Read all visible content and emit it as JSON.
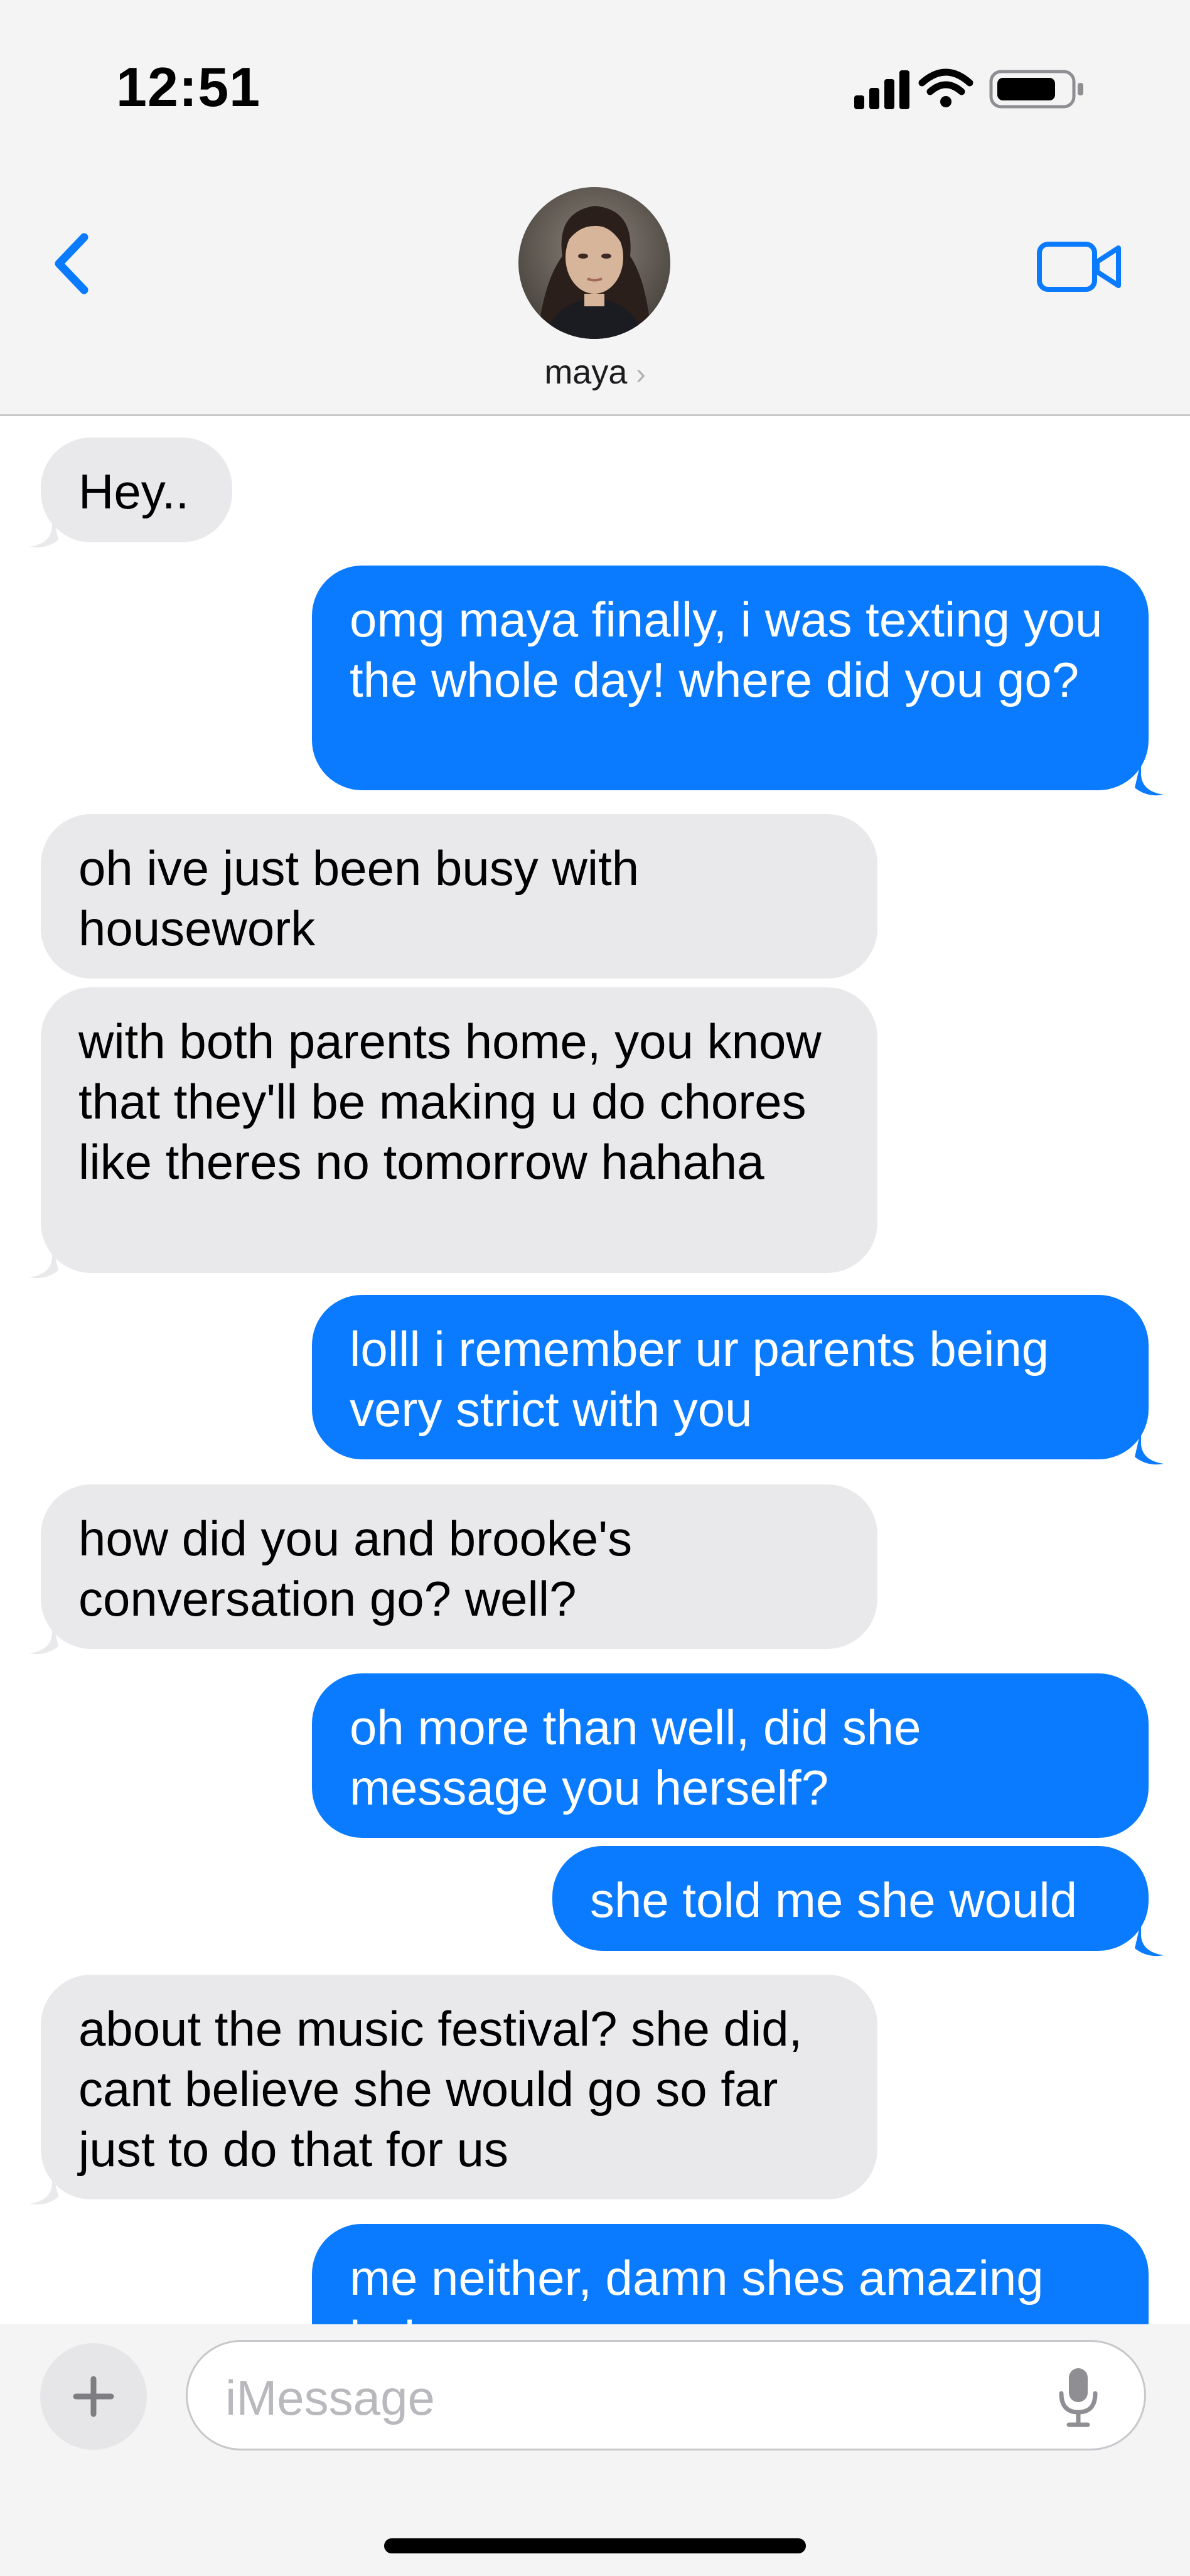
{
  "status_bar": {
    "time": "12:51"
  },
  "header": {
    "contact_name": "maya",
    "chevron": "›"
  },
  "icons": {
    "back": "chevron-left-icon",
    "video": "video-camera-icon",
    "plus": "plus-icon",
    "mic": "microphone-icon"
  },
  "colors": {
    "accent": "#0a7bff",
    "incoming_bubble": "#e9e9eb",
    "outgoing_bubble": "#0a7bff"
  },
  "messages": [
    {
      "direction": "in",
      "text": "Hey.."
    },
    {
      "direction": "out",
      "text": "omg maya finally, i was texting you the whole day! where did you go?"
    },
    {
      "direction": "in",
      "text": "oh ive just been busy with housework"
    },
    {
      "direction": "in",
      "text": "with both parents home, you know that they'll be making u do chores like theres no tomorrow hahaha"
    },
    {
      "direction": "out",
      "text": "lolll i remember ur parents being very strict with you"
    },
    {
      "direction": "in",
      "text": "how did you and brooke's conversation go? well?"
    },
    {
      "direction": "out",
      "text": "oh more than well, did she message you herself?"
    },
    {
      "direction": "out",
      "text": "she told me she would"
    },
    {
      "direction": "in",
      "text": "about the music festival? she did, cant believe she would go so far just to do that for us"
    },
    {
      "direction": "out",
      "text": "me neither, damn shes amazing haha"
    }
  ],
  "composer": {
    "placeholder": "iMessage"
  }
}
